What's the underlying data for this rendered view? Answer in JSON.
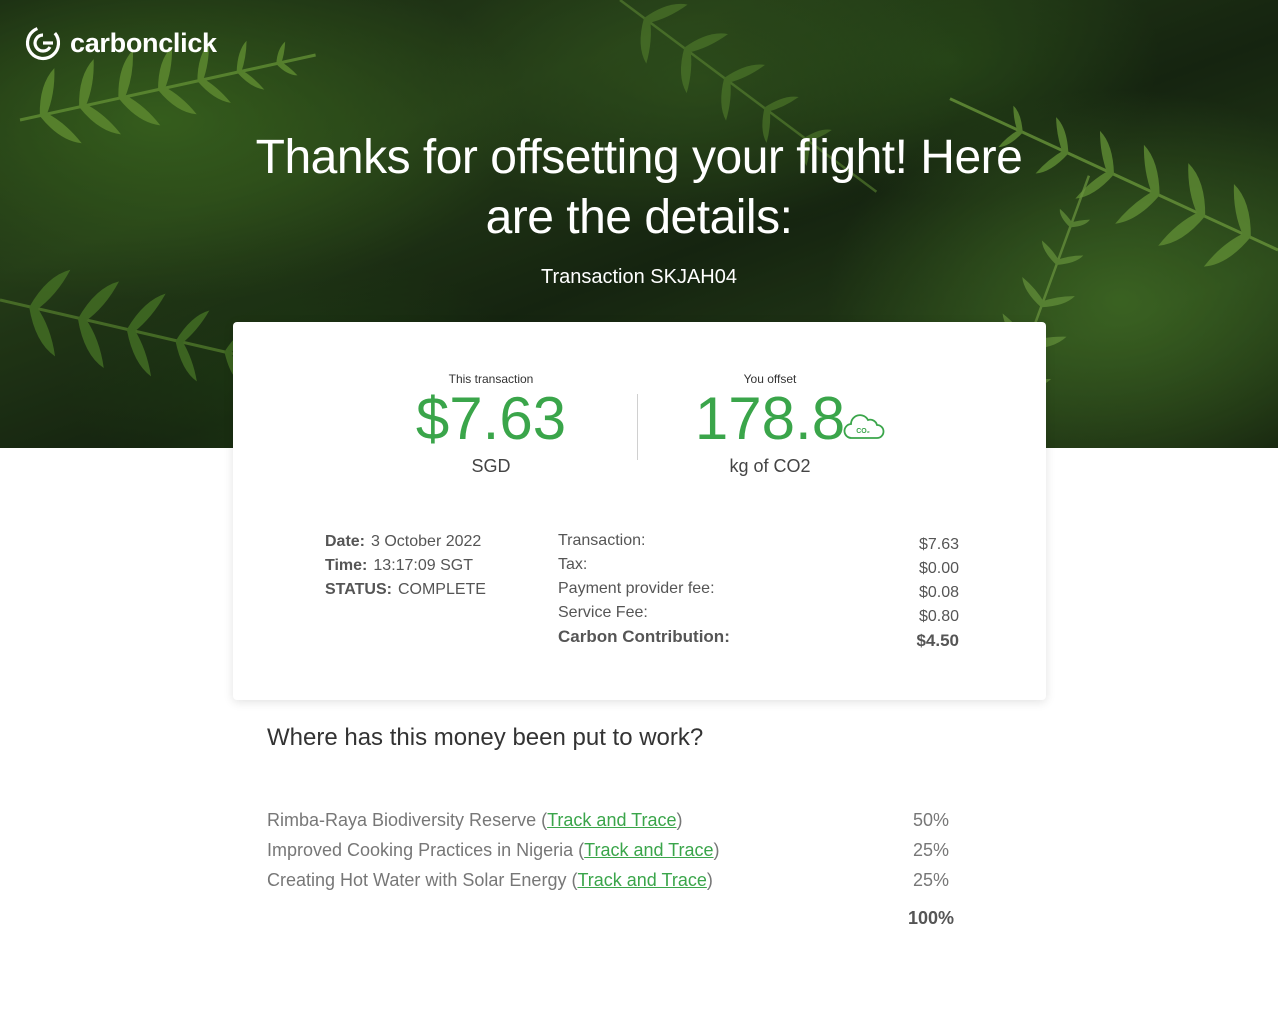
{
  "brand": {
    "name": "carbonclick",
    "icon": "carbonclick-logo-icon"
  },
  "hero": {
    "headline": "Thanks for offsetting your flight! Here are the details:",
    "transaction_id": "Transaction SKJAH04"
  },
  "summary": {
    "cost_label": "This transaction",
    "cost_value": "$7.63",
    "cost_unit": "SGD",
    "offset_label": "You offset",
    "offset_value": "178.8",
    "offset_unit": "kg of CO2",
    "offset_icon": "co2-cloud-icon",
    "offset_icon_text": "CO₂"
  },
  "meta": {
    "date_label": "Date:",
    "date_value": "3 October 2022",
    "time_label": "Time:",
    "time_value": "13:17:09 SGT",
    "status_label": "STATUS:",
    "status_value": "COMPLETE"
  },
  "fees": [
    {
      "label": "Transaction:",
      "value": "$7.63"
    },
    {
      "label": "Tax:",
      "value": "$0.00"
    },
    {
      "label": "Payment provider fee:",
      "value": "$0.08"
    },
    {
      "label": "Service Fee:",
      "value": "$0.80"
    },
    {
      "label": "Carbon Contribution:",
      "value": "$4.50"
    }
  ],
  "allocation": {
    "title": "Where has this money been put to work?",
    "link_text": "Track and Trace",
    "projects": [
      {
        "name": "Rimba-Raya Biodiversity Reserve",
        "percent": "50%"
      },
      {
        "name": "Improved Cooking Practices in Nigeria",
        "percent": "25%"
      },
      {
        "name": "Creating Hot Water with Solar Energy",
        "percent": "25%"
      }
    ],
    "total": "100%"
  },
  "colors": {
    "accent": "#3aa54a",
    "text": "#4a4a4a",
    "hero_green": "#2e4a1e"
  }
}
